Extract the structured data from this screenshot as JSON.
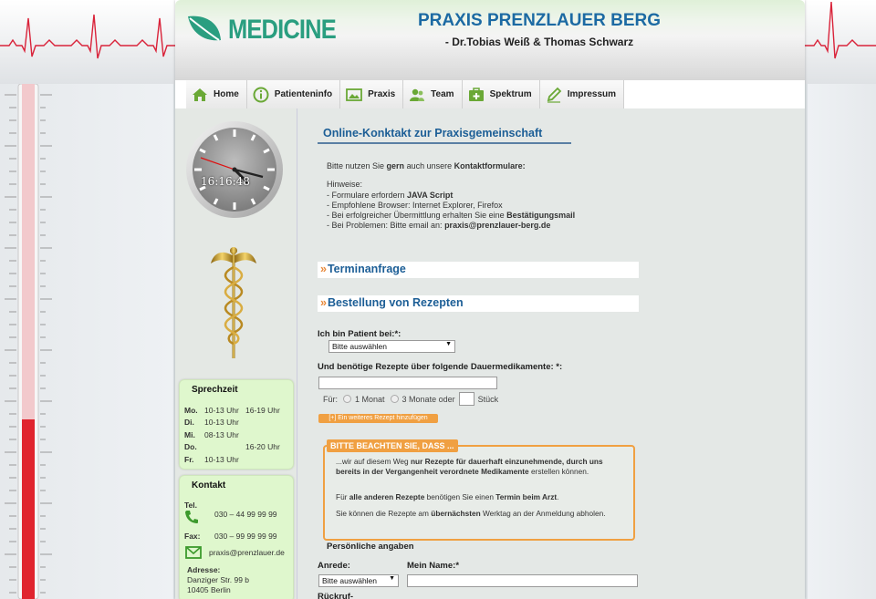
{
  "header": {
    "logo_text": "MEDICINE",
    "title": "PRAXIS PRENZLAUER BERG",
    "subtitle": "- Dr.Tobias Weiß & Thomas Schwarz"
  },
  "nav": [
    {
      "label": "Home",
      "icon": "home-icon"
    },
    {
      "label": "Patienteninfo",
      "icon": "info-icon"
    },
    {
      "label": "Praxis",
      "icon": "image-icon"
    },
    {
      "label": "Team",
      "icon": "team-icon"
    },
    {
      "label": "Spektrum",
      "icon": "medkit-icon"
    },
    {
      "label": "Impressum",
      "icon": "pen-icon"
    }
  ],
  "sidebar": {
    "clock_time": "16:16:48",
    "sprechzeit": {
      "title": "Sprechzeit",
      "rows": [
        {
          "day": "Mo.",
          "am": "10-13 Uhr",
          "pm": "16-19 Uhr"
        },
        {
          "day": "Di.",
          "am": "10-13 Uhr",
          "pm": ""
        },
        {
          "day": "Mi.",
          "am": "08-13 Uhr",
          "pm": ""
        },
        {
          "day": "Do.",
          "am": "",
          "pm": "16-20 Uhr"
        },
        {
          "day": "Fr.",
          "am": "10-13 Uhr",
          "pm": ""
        }
      ]
    },
    "kontakt": {
      "title": "Kontakt",
      "tel_label": "Tel.",
      "tel": "030 – 44 99 99 99",
      "fax_label": "Fax:",
      "fax": "030 – 99 99 99 99",
      "email": "praxis@prenzlauer.de",
      "address_label": "Adresse:",
      "street": "Danziger Str. 99 b",
      "city": "10405 Berlin"
    }
  },
  "main": {
    "page_title": "Online-Konktakt zur Praxisgemeinschaft",
    "intro_pre": "Bitte nutzen Sie ",
    "intro_bold1": "gern",
    "intro_mid": " auch unsere ",
    "intro_bold2": "Kontaktformulare:",
    "hints_title": "Hinweise:",
    "hint1_pre": "- Formulare erfordern ",
    "hint1_bold": "JAVA Script",
    "hint2": "- Empfohlene Browser: Internet Explorer, Firefox",
    "hint3_pre": "- Bei erfolgreicher Übermittlung erhalten Sie eine ",
    "hint3_bold": "Bestätigungsmail",
    "hint4_pre": "- Bei Problemen: Bitte email an: ",
    "hint4_bold": "praxis@prenzlauer-berg.de",
    "section1": "Terminanfrage",
    "section2": "Bestellung von Rezepten",
    "patient_label": "Ich bin Patient bei:*:",
    "patient_select": "Bitte auswählen",
    "rezept_label": "Und benötige Rezepte über folgende Dauermedikamente: *:",
    "fuer_label": "Für:",
    "option1": "1 Monat",
    "option2": "3 Monate oder",
    "stueck": "Stück",
    "add_button": "[+] Ein weiteres Rezept hinzufügen",
    "notice": {
      "title": "BITTE BEACHTEN SIE, DASS ...",
      "p1_pre": "...wir auf diesem Weg ",
      "p1_bold": "nur Rezepte für dauerhaft einzunehmende, durch uns bereits in der Vergangenheit verordnete Medikamente",
      "p1_post": " erstellen können.",
      "p2_pre": "Für ",
      "p2_bold1": "alle anderen Rezepte",
      "p2_mid": " benötigen Sie einen ",
      "p2_bold2": "Termin beim Arzt",
      "p2_post": ".",
      "p3_pre": "Sie können die Rezepte am ",
      "p3_bold": "übernächsten",
      "p3_post": " Werktag an der Anmeldung abholen."
    },
    "personal_title": "Persönliche angaben",
    "anrede_label": "Anrede:",
    "anrede_select": "Bitte auswählen",
    "name_label": "Mein Name:*",
    "rueckruf_label": "Rückruf-"
  },
  "colors": {
    "accent_blue": "#1c5e96",
    "orange": "#f0a042",
    "green": "#2a9e80",
    "box_green": "#dff7cd"
  }
}
